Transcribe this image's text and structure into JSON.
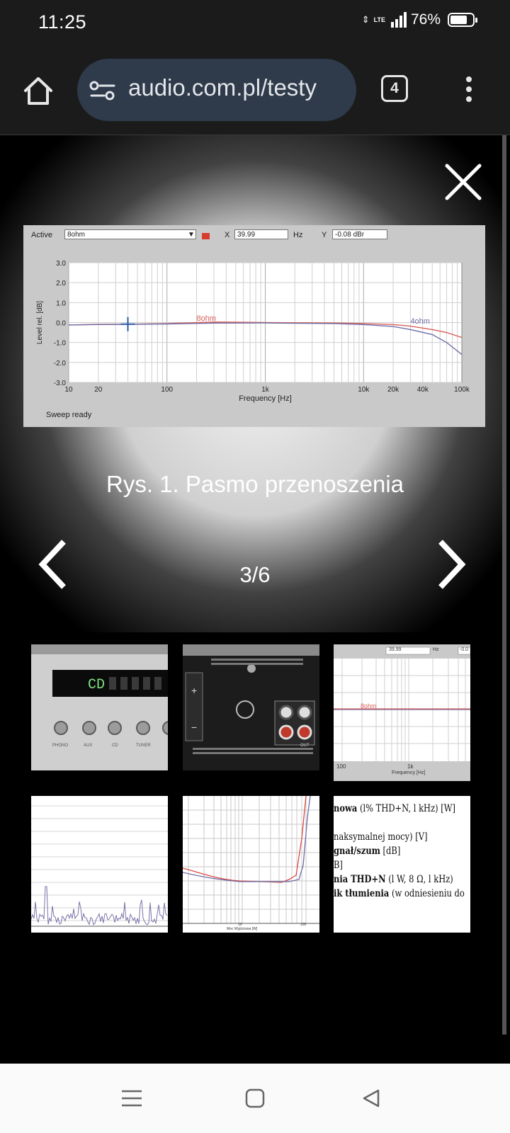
{
  "status_bar": {
    "time": "11:25",
    "network": "LTE",
    "battery": "76%",
    "battery_level": 0.76
  },
  "browser": {
    "url": "audio.com.pl/testy",
    "tab_count": "4"
  },
  "viewer": {
    "caption": "Rys. 1. Pasmo przenoszenia",
    "counter": "3/6"
  },
  "figure_toolbar": {
    "active_label": "Active",
    "active_value": "8ohm",
    "x_label": "X",
    "x_value": "39.99",
    "x_unit": "Hz",
    "y_label": "Y",
    "y_value": "-0.08 dBr"
  },
  "figure_status": "Sweep ready",
  "chart_data": {
    "type": "line",
    "xlabel": "Frequency [Hz]",
    "ylabel": "Level rel. [dB]",
    "x_scale": "log",
    "xlim": [
      10,
      100000
    ],
    "ylim": [
      -3,
      3
    ],
    "x_ticks": [
      "10",
      "20",
      "100",
      "1k",
      "10k",
      "20k",
      "40k",
      "100k"
    ],
    "x_tick_values": [
      10,
      20,
      100,
      1000,
      10000,
      20000,
      40000,
      100000
    ],
    "y_ticks": [
      "3.0",
      "2.0",
      "1.0",
      "0.0",
      "-1.0",
      "-2.0",
      "-3.0"
    ],
    "y_tick_values": [
      3,
      2,
      1,
      0,
      -1,
      -2,
      -3
    ],
    "series": [
      {
        "name": "8ohm",
        "color": "#d9605a",
        "x": [
          10,
          20,
          40,
          100,
          300,
          1000,
          5000,
          10000,
          20000,
          30000,
          50000,
          70000,
          100000
        ],
        "y": [
          -0.12,
          -0.09,
          -0.08,
          -0.05,
          0.03,
          0.0,
          -0.02,
          -0.05,
          -0.1,
          -0.18,
          -0.35,
          -0.5,
          -0.75
        ]
      },
      {
        "name": "4ohm",
        "color": "#6f6fa8",
        "x": [
          10,
          20,
          40,
          100,
          300,
          1000,
          5000,
          10000,
          20000,
          30000,
          50000,
          70000,
          100000
        ],
        "y": [
          -0.12,
          -0.1,
          -0.09,
          -0.07,
          -0.03,
          -0.02,
          -0.05,
          -0.1,
          -0.2,
          -0.35,
          -0.6,
          -1.0,
          -1.6
        ]
      }
    ],
    "grid": true,
    "cursor": {
      "x": 39.99,
      "y": -0.08
    }
  },
  "thumb3": {
    "x_value": "39.99",
    "x_unit": "Hz",
    "y_value": "-0.0",
    "series_label": "8ohm",
    "x_tick_1": "100",
    "x_tick_2": "1k",
    "xlabel": "Frequency [Hz]"
  },
  "thumb1": {
    "labels": [
      "PHONO",
      "AUX",
      "CD",
      "TUNER"
    ]
  },
  "thumb2": {
    "out_label": "OUT"
  },
  "thumb5": {
    "x_tick_1": "10",
    "x_tick_2": "100",
    "xlabel": "Moc Wyjściowa [W]"
  },
  "thumb6": {
    "lines": [
      {
        "bold": "nowa",
        "rest": " (l% THD+N, l kHz) [W]"
      },
      {
        "bold": "",
        "rest": ""
      },
      {
        "bold": "",
        "rest": "naksymalnej mocy) [V]"
      },
      {
        "bold": "gnał/szum",
        "rest": " [dB]"
      },
      {
        "bold": "",
        "rest": "B]"
      },
      {
        "bold": "nia THD+N",
        "rest": " (l W, 8 Ω, l kHz)"
      },
      {
        "bold": "ik tłumienia",
        "rest": " (w odniesieniu do"
      }
    ]
  }
}
